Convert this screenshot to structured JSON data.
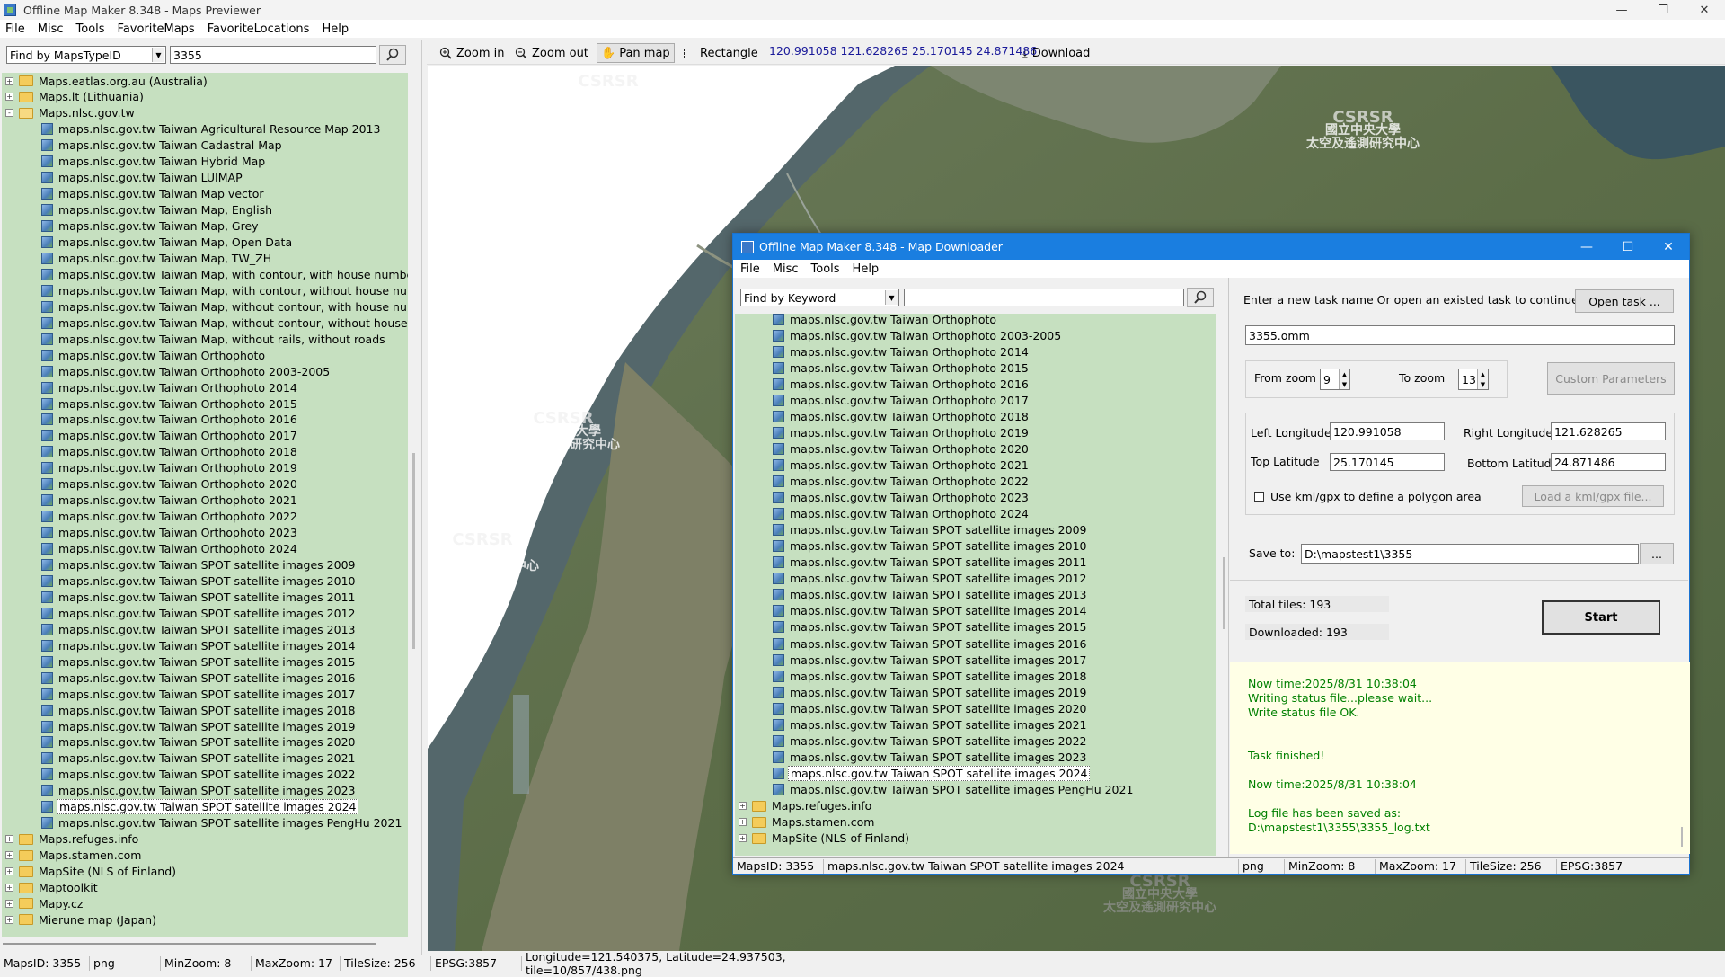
{
  "main_window": {
    "title": "Offline Map Maker 8.348 - Maps Previewer",
    "menu": [
      "File",
      "Misc",
      "Tools",
      "FavoriteMaps",
      "FavoriteLocations",
      "Help"
    ]
  },
  "left_panel": {
    "find_mode": "Find by MapsTypeID",
    "find_value": "3355",
    "tree": [
      {
        "label": "Maps.eatlas.org.au (Australia)",
        "kind": "folder",
        "level": 0,
        "expander": "+"
      },
      {
        "label": "Maps.lt (Lithuania)",
        "kind": "folder",
        "level": 0,
        "expander": "+"
      },
      {
        "label": "Maps.nlsc.gov.tw",
        "kind": "folder-open",
        "level": 0,
        "expander": "-"
      },
      {
        "label": "maps.nlsc.gov.tw Taiwan Agricultural Resource Map 2013",
        "kind": "map",
        "level": 1
      },
      {
        "label": "maps.nlsc.gov.tw Taiwan Cadastral Map",
        "kind": "map",
        "level": 1
      },
      {
        "label": "maps.nlsc.gov.tw Taiwan Hybrid Map",
        "kind": "map",
        "level": 1
      },
      {
        "label": "maps.nlsc.gov.tw Taiwan LUIMAP",
        "kind": "map",
        "level": 1
      },
      {
        "label": "maps.nlsc.gov.tw Taiwan Map vector",
        "kind": "map",
        "level": 1
      },
      {
        "label": "maps.nlsc.gov.tw Taiwan Map, English",
        "kind": "map",
        "level": 1
      },
      {
        "label": "maps.nlsc.gov.tw Taiwan Map, Grey",
        "kind": "map",
        "level": 1
      },
      {
        "label": "maps.nlsc.gov.tw Taiwan Map, Open Data",
        "kind": "map",
        "level": 1
      },
      {
        "label": "maps.nlsc.gov.tw Taiwan Map, TW_ZH",
        "kind": "map",
        "level": 1
      },
      {
        "label": "maps.nlsc.gov.tw Taiwan Map, with contour, with house number",
        "kind": "map",
        "level": 1
      },
      {
        "label": "maps.nlsc.gov.tw Taiwan Map, with contour, without house number",
        "kind": "map",
        "level": 1
      },
      {
        "label": "maps.nlsc.gov.tw Taiwan Map, without contour, with house number",
        "kind": "map",
        "level": 1
      },
      {
        "label": "maps.nlsc.gov.tw Taiwan Map, without contour, without house num",
        "kind": "map",
        "level": 1
      },
      {
        "label": "maps.nlsc.gov.tw Taiwan Map, without rails, without roads",
        "kind": "map",
        "level": 1
      },
      {
        "label": "maps.nlsc.gov.tw Taiwan Orthophoto",
        "kind": "map",
        "level": 1
      },
      {
        "label": "maps.nlsc.gov.tw Taiwan Orthophoto 2003-2005",
        "kind": "map",
        "level": 1
      },
      {
        "label": "maps.nlsc.gov.tw Taiwan Orthophoto 2014",
        "kind": "map",
        "level": 1
      },
      {
        "label": "maps.nlsc.gov.tw Taiwan Orthophoto 2015",
        "kind": "map",
        "level": 1
      },
      {
        "label": "maps.nlsc.gov.tw Taiwan Orthophoto 2016",
        "kind": "map",
        "level": 1
      },
      {
        "label": "maps.nlsc.gov.tw Taiwan Orthophoto 2017",
        "kind": "map",
        "level": 1
      },
      {
        "label": "maps.nlsc.gov.tw Taiwan Orthophoto 2018",
        "kind": "map",
        "level": 1
      },
      {
        "label": "maps.nlsc.gov.tw Taiwan Orthophoto 2019",
        "kind": "map",
        "level": 1
      },
      {
        "label": "maps.nlsc.gov.tw Taiwan Orthophoto 2020",
        "kind": "map",
        "level": 1
      },
      {
        "label": "maps.nlsc.gov.tw Taiwan Orthophoto 2021",
        "kind": "map",
        "level": 1
      },
      {
        "label": "maps.nlsc.gov.tw Taiwan Orthophoto 2022",
        "kind": "map",
        "level": 1
      },
      {
        "label": "maps.nlsc.gov.tw Taiwan Orthophoto 2023",
        "kind": "map",
        "level": 1
      },
      {
        "label": "maps.nlsc.gov.tw Taiwan Orthophoto 2024",
        "kind": "map",
        "level": 1
      },
      {
        "label": "maps.nlsc.gov.tw Taiwan SPOT satellite images 2009",
        "kind": "map",
        "level": 1
      },
      {
        "label": "maps.nlsc.gov.tw Taiwan SPOT satellite images 2010",
        "kind": "map",
        "level": 1
      },
      {
        "label": "maps.nlsc.gov.tw Taiwan SPOT satellite images 2011",
        "kind": "map",
        "level": 1
      },
      {
        "label": "maps.nlsc.gov.tw Taiwan SPOT satellite images 2012",
        "kind": "map",
        "level": 1
      },
      {
        "label": "maps.nlsc.gov.tw Taiwan SPOT satellite images 2013",
        "kind": "map",
        "level": 1
      },
      {
        "label": "maps.nlsc.gov.tw Taiwan SPOT satellite images 2014",
        "kind": "map",
        "level": 1
      },
      {
        "label": "maps.nlsc.gov.tw Taiwan SPOT satellite images 2015",
        "kind": "map",
        "level": 1
      },
      {
        "label": "maps.nlsc.gov.tw Taiwan SPOT satellite images 2016",
        "kind": "map",
        "level": 1
      },
      {
        "label": "maps.nlsc.gov.tw Taiwan SPOT satellite images 2017",
        "kind": "map",
        "level": 1
      },
      {
        "label": "maps.nlsc.gov.tw Taiwan SPOT satellite images 2018",
        "kind": "map",
        "level": 1
      },
      {
        "label": "maps.nlsc.gov.tw Taiwan SPOT satellite images 2019",
        "kind": "map",
        "level": 1
      },
      {
        "label": "maps.nlsc.gov.tw Taiwan SPOT satellite images 2020",
        "kind": "map",
        "level": 1
      },
      {
        "label": "maps.nlsc.gov.tw Taiwan SPOT satellite images 2021",
        "kind": "map",
        "level": 1
      },
      {
        "label": "maps.nlsc.gov.tw Taiwan SPOT satellite images 2022",
        "kind": "map",
        "level": 1
      },
      {
        "label": "maps.nlsc.gov.tw Taiwan SPOT satellite images 2023",
        "kind": "map",
        "level": 1
      },
      {
        "label": "maps.nlsc.gov.tw Taiwan SPOT satellite images 2024",
        "kind": "map",
        "level": 1,
        "selected": true
      },
      {
        "label": "maps.nlsc.gov.tw Taiwan SPOT satellite images PengHu 2021",
        "kind": "map",
        "level": 1
      },
      {
        "label": "Maps.refuges.info",
        "kind": "folder",
        "level": 0,
        "expander": "+"
      },
      {
        "label": "Maps.stamen.com",
        "kind": "folder",
        "level": 0,
        "expander": "+"
      },
      {
        "label": "MapSite (NLS of Finland)",
        "kind": "folder",
        "level": 0,
        "expander": "+"
      },
      {
        "label": "Maptoolkit",
        "kind": "folder",
        "level": 0,
        "expander": "+"
      },
      {
        "label": "Mapy.cz",
        "kind": "folder",
        "level": 0,
        "expander": "+"
      },
      {
        "label": "Mierune map (Japan)",
        "kind": "folder",
        "level": 0,
        "expander": "+"
      }
    ]
  },
  "toolbar": {
    "zoom_in": "Zoom in",
    "zoom_out": "Zoom out",
    "pan_map": "Pan map",
    "rectangle": "Rectangle",
    "bounds": "120.991058 121.628265 25.170145 24.871486",
    "download": "Download"
  },
  "map_watermarks": {
    "logo": "CSRSR",
    "line1": "國立中央大學",
    "line2": "太空及遙測研究中心"
  },
  "status_bar": [
    "MapsID: 3355",
    "png",
    "MinZoom: 8",
    "MaxZoom: 17",
    "TileSize: 256",
    "EPSG:3857",
    "Longitude=121.540375, Latitude=24.937503, tile=10/857/438.png"
  ],
  "downloader": {
    "title": "Offline Map Maker 8.348 - Map Downloader",
    "menu": [
      "File",
      "Misc",
      "Tools",
      "Help"
    ],
    "find_mode": "Find by Keyword",
    "find_value": "",
    "tree": [
      {
        "label": "maps.nlsc.gov.tw Taiwan Orthophoto",
        "kind": "map",
        "level": 1
      },
      {
        "label": "maps.nlsc.gov.tw Taiwan Orthophoto 2003-2005",
        "kind": "map",
        "level": 1
      },
      {
        "label": "maps.nlsc.gov.tw Taiwan Orthophoto 2014",
        "kind": "map",
        "level": 1
      },
      {
        "label": "maps.nlsc.gov.tw Taiwan Orthophoto 2015",
        "kind": "map",
        "level": 1
      },
      {
        "label": "maps.nlsc.gov.tw Taiwan Orthophoto 2016",
        "kind": "map",
        "level": 1
      },
      {
        "label": "maps.nlsc.gov.tw Taiwan Orthophoto 2017",
        "kind": "map",
        "level": 1
      },
      {
        "label": "maps.nlsc.gov.tw Taiwan Orthophoto 2018",
        "kind": "map",
        "level": 1
      },
      {
        "label": "maps.nlsc.gov.tw Taiwan Orthophoto 2019",
        "kind": "map",
        "level": 1
      },
      {
        "label": "maps.nlsc.gov.tw Taiwan Orthophoto 2020",
        "kind": "map",
        "level": 1
      },
      {
        "label": "maps.nlsc.gov.tw Taiwan Orthophoto 2021",
        "kind": "map",
        "level": 1
      },
      {
        "label": "maps.nlsc.gov.tw Taiwan Orthophoto 2022",
        "kind": "map",
        "level": 1
      },
      {
        "label": "maps.nlsc.gov.tw Taiwan Orthophoto 2023",
        "kind": "map",
        "level": 1
      },
      {
        "label": "maps.nlsc.gov.tw Taiwan Orthophoto 2024",
        "kind": "map",
        "level": 1
      },
      {
        "label": "maps.nlsc.gov.tw Taiwan SPOT satellite images 2009",
        "kind": "map",
        "level": 1
      },
      {
        "label": "maps.nlsc.gov.tw Taiwan SPOT satellite images 2010",
        "kind": "map",
        "level": 1
      },
      {
        "label": "maps.nlsc.gov.tw Taiwan SPOT satellite images 2011",
        "kind": "map",
        "level": 1
      },
      {
        "label": "maps.nlsc.gov.tw Taiwan SPOT satellite images 2012",
        "kind": "map",
        "level": 1
      },
      {
        "label": "maps.nlsc.gov.tw Taiwan SPOT satellite images 2013",
        "kind": "map",
        "level": 1
      },
      {
        "label": "maps.nlsc.gov.tw Taiwan SPOT satellite images 2014",
        "kind": "map",
        "level": 1
      },
      {
        "label": "maps.nlsc.gov.tw Taiwan SPOT satellite images 2015",
        "kind": "map",
        "level": 1
      },
      {
        "label": "maps.nlsc.gov.tw Taiwan SPOT satellite images 2016",
        "kind": "map",
        "level": 1
      },
      {
        "label": "maps.nlsc.gov.tw Taiwan SPOT satellite images 2017",
        "kind": "map",
        "level": 1
      },
      {
        "label": "maps.nlsc.gov.tw Taiwan SPOT satellite images 2018",
        "kind": "map",
        "level": 1
      },
      {
        "label": "maps.nlsc.gov.tw Taiwan SPOT satellite images 2019",
        "kind": "map",
        "level": 1
      },
      {
        "label": "maps.nlsc.gov.tw Taiwan SPOT satellite images 2020",
        "kind": "map",
        "level": 1
      },
      {
        "label": "maps.nlsc.gov.tw Taiwan SPOT satellite images 2021",
        "kind": "map",
        "level": 1
      },
      {
        "label": "maps.nlsc.gov.tw Taiwan SPOT satellite images 2022",
        "kind": "map",
        "level": 1
      },
      {
        "label": "maps.nlsc.gov.tw Taiwan SPOT satellite images 2023",
        "kind": "map",
        "level": 1
      },
      {
        "label": "maps.nlsc.gov.tw Taiwan SPOT satellite images 2024",
        "kind": "map",
        "level": 1,
        "selected": true
      },
      {
        "label": "maps.nlsc.gov.tw Taiwan SPOT satellite images PengHu 2021",
        "kind": "map",
        "level": 1
      },
      {
        "label": "Maps.refuges.info",
        "kind": "folder",
        "level": 0,
        "expander": "+"
      },
      {
        "label": "Maps.stamen.com",
        "kind": "folder",
        "level": 0,
        "expander": "+"
      },
      {
        "label": "MapSite (NLS of Finland)",
        "kind": "folder",
        "level": 0,
        "expander": "+"
      }
    ],
    "task_prompt": "Enter a new task name Or open an existed task to continue:",
    "open_task_button": "Open task ...",
    "task_name": "3355.omm",
    "from_zoom_label": "From zoom",
    "from_zoom": "9",
    "to_zoom_label": "To zoom",
    "to_zoom": "13",
    "custom_parameters_button": "Custom Parameters",
    "left_longitude_label": "Left Longitude",
    "left_longitude": "120.991058",
    "right_longitude_label": "Right Longitude",
    "right_longitude": "121.628265",
    "top_latitude_label": "Top Latitude",
    "top_latitude": "25.170145",
    "bottom_latitude_label": "Bottom Latitude",
    "bottom_latitude": "24.871486",
    "use_kml_label": "Use kml/gpx to define a polygon area",
    "use_kml_checked": false,
    "load_kml_button": "Load a kml/gpx file...",
    "save_to_label": "Save to:",
    "save_to": "D:\\mapstest1\\3355",
    "browse_button": "...",
    "total_tiles": "Total tiles: 193",
    "downloaded": "Downloaded: 193",
    "start_button": "Start",
    "log": [
      "Now time:2025/8/31 10:38:04",
      "Writing status file...please wait...",
      "Write status file OK.",
      "",
      "--------------------------------",
      "Task finished!",
      "",
      "Now time:2025/8/31 10:38:04",
      "",
      "Log file has been saved as:",
      "D:\\mapstest1\\3355\\3355_log.txt"
    ],
    "status_bar": [
      "MapsID: 3355",
      "maps.nlsc.gov.tw Taiwan SPOT satellite images 2024",
      "png",
      "MinZoom: 8",
      "MaxZoom: 17",
      "TileSize: 256",
      "EPSG:3857"
    ]
  },
  "colors": {
    "tree_bg": "#c6e0c0",
    "dialog_title": "#1a7ee0",
    "log_text": "#008000",
    "coords_text": "#1a1a9a"
  }
}
